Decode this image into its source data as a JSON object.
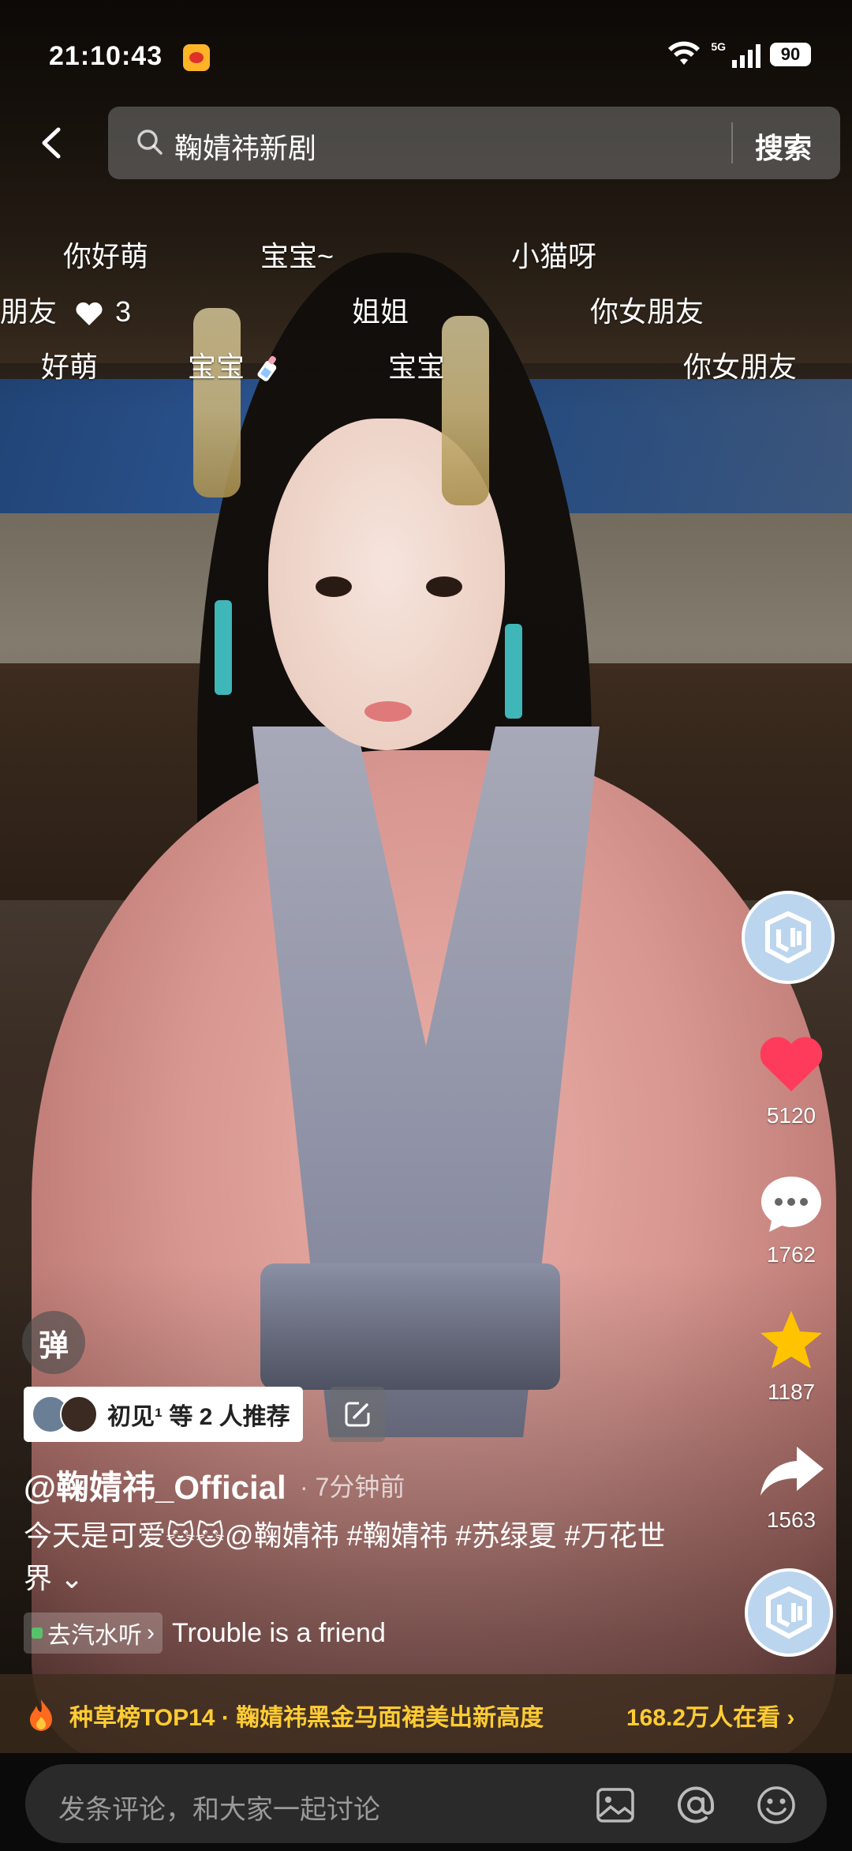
{
  "status_bar": {
    "time": "21:10:43",
    "network": "5G",
    "battery": "90"
  },
  "search": {
    "query": "鞠婧祎新剧",
    "button": "搜索"
  },
  "danmaku": [
    "你好萌",
    "宝宝~",
    "小猫呀",
    "朋友",
    "3",
    "姐姐",
    "你女朋友",
    "好萌",
    "宝宝",
    "宝宝",
    "你女朋友"
  ],
  "actions": {
    "likes": "5120",
    "comments": "1762",
    "favorites": "1187",
    "shares": "1563"
  },
  "danmu_toggle": "弹",
  "recommend": {
    "text": "初见¹ 等 2 人推荐"
  },
  "post": {
    "author": "@鞠婧祎_Official",
    "time": "· 7分钟前",
    "caption": "今天是可爱🐱🐱@鞠婧祎 #鞠婧祎 #苏绿夏 #万花世界 ⌄"
  },
  "music": {
    "tag": "去汽水听",
    "title": "Trouble is a friend"
  },
  "hot": {
    "text": "种草榜TOP14 · 鞠婧祎黑金马面裙美出新高度",
    "viewers": "168.2万人在看 ›"
  },
  "comment": {
    "placeholder": "发条评论，和大家一起讨论"
  }
}
